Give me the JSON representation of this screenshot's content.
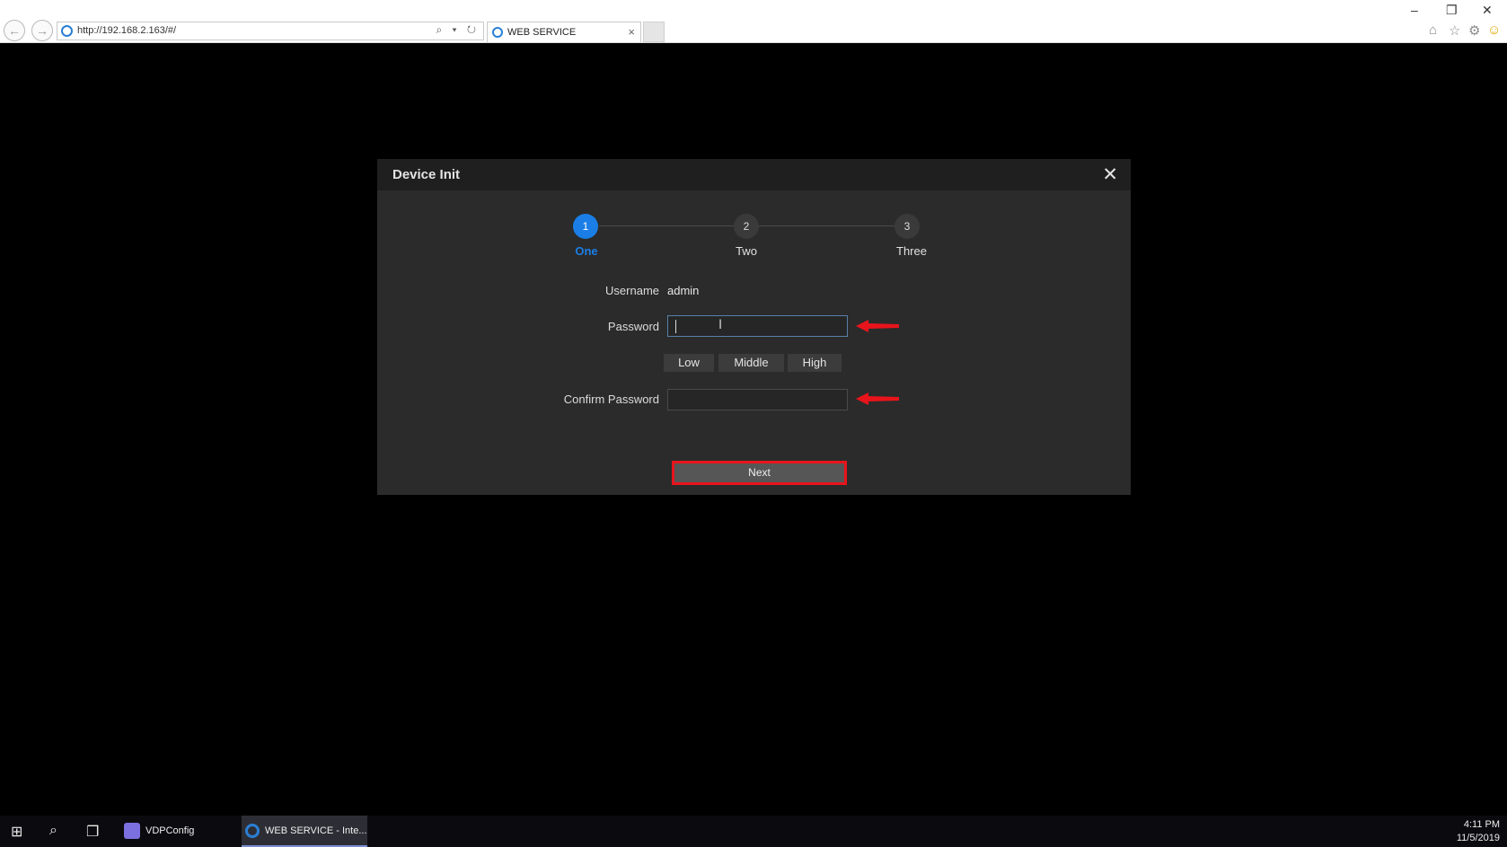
{
  "browser": {
    "url": "http://192.168.2.163/#/",
    "tab_title": "WEB SERVICE",
    "tab_close": "×",
    "back_icon": "←",
    "forward_icon": "→",
    "addr_tools": "⌕ ▾ ↻",
    "window_controls": {
      "minimize": "–",
      "restore": "❐",
      "close": "✕"
    },
    "right_icons": {
      "home": "⌂",
      "favorites": "☆",
      "settings": "⚙",
      "feedback": "☺"
    }
  },
  "dialog": {
    "title": "Device Init",
    "close_icon": "✕",
    "steps": [
      {
        "number": "1",
        "label": "One",
        "active": true
      },
      {
        "number": "2",
        "label": "Two",
        "active": false
      },
      {
        "number": "3",
        "label": "Three",
        "active": false
      }
    ],
    "form": {
      "username_label": "Username",
      "username_value": "admin",
      "password_label": "Password",
      "password_value": "",
      "confirm_label": "Confirm Password",
      "confirm_value": "",
      "strength": [
        "Low",
        "Middle",
        "High"
      ]
    },
    "next_label": "Next"
  },
  "taskbar": {
    "start_icon": "⊞",
    "search_icon": "⌕",
    "taskview_icon": "❐",
    "apps": [
      {
        "label": "VDPConfig"
      },
      {
        "label": "WEB SERVICE - Inte..."
      }
    ],
    "time": "4:11 PM",
    "date": "11/5/2019"
  },
  "colors": {
    "accent": "#1a7ee6",
    "annotation_red": "#e8141b",
    "dialog_bg": "#2b2b2b"
  }
}
